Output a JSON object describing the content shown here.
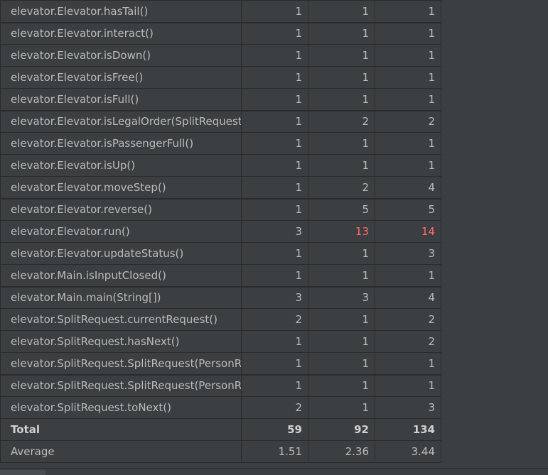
{
  "metrics_table": {
    "rows": [
      {
        "method": "elevator.Elevator.hasTail()",
        "a": "1",
        "b": "1",
        "c": "1"
      },
      {
        "method": "elevator.Elevator.interact()",
        "a": "1",
        "b": "1",
        "c": "1"
      },
      {
        "method": "elevator.Elevator.isDown()",
        "a": "1",
        "b": "1",
        "c": "1"
      },
      {
        "method": "elevator.Elevator.isFree()",
        "a": "1",
        "b": "1",
        "c": "1"
      },
      {
        "method": "elevator.Elevator.isFull()",
        "a": "1",
        "b": "1",
        "c": "1"
      },
      {
        "method": "elevator.Elevator.isLegalOrder(SplitRequest)",
        "a": "1",
        "b": "2",
        "c": "2"
      },
      {
        "method": "elevator.Elevator.isPassengerFull()",
        "a": "1",
        "b": "1",
        "c": "1"
      },
      {
        "method": "elevator.Elevator.isUp()",
        "a": "1",
        "b": "1",
        "c": "1"
      },
      {
        "method": "elevator.Elevator.moveStep()",
        "a": "1",
        "b": "2",
        "c": "4"
      },
      {
        "method": "elevator.Elevator.reverse()",
        "a": "1",
        "b": "5",
        "c": "5"
      },
      {
        "method": "elevator.Elevator.run()",
        "a": "3",
        "b": "13",
        "c": "14"
      },
      {
        "method": "elevator.Elevator.updateStatus()",
        "a": "1",
        "b": "1",
        "c": "3"
      },
      {
        "method": "elevator.Main.isInputClosed()",
        "a": "1",
        "b": "1",
        "c": "1"
      },
      {
        "method": "elevator.Main.main(String[])",
        "a": "3",
        "b": "3",
        "c": "4"
      },
      {
        "method": "elevator.SplitRequest.currentRequest()",
        "a": "2",
        "b": "1",
        "c": "2"
      },
      {
        "method": "elevator.SplitRequest.hasNext()",
        "a": "1",
        "b": "1",
        "c": "2"
      },
      {
        "method": "elevator.SplitRequest.SplitRequest(PersonRe",
        "a": "1",
        "b": "1",
        "c": "1"
      },
      {
        "method": "elevator.SplitRequest.SplitRequest(PersonRe",
        "a": "1",
        "b": "1",
        "c": "1"
      },
      {
        "method": "elevator.SplitRequest.toNext()",
        "a": "2",
        "b": "1",
        "c": "3"
      }
    ],
    "total": {
      "label": "Total",
      "a": "59",
      "b": "92",
      "c": "134"
    },
    "average": {
      "label": "Average",
      "a": "1.51",
      "b": "2.36",
      "c": "3.44"
    }
  },
  "colors": {
    "background": "#3c3f41",
    "text": "#bbbbbb",
    "grid": "#2b2b2b",
    "highlight": "#ff6b68"
  }
}
